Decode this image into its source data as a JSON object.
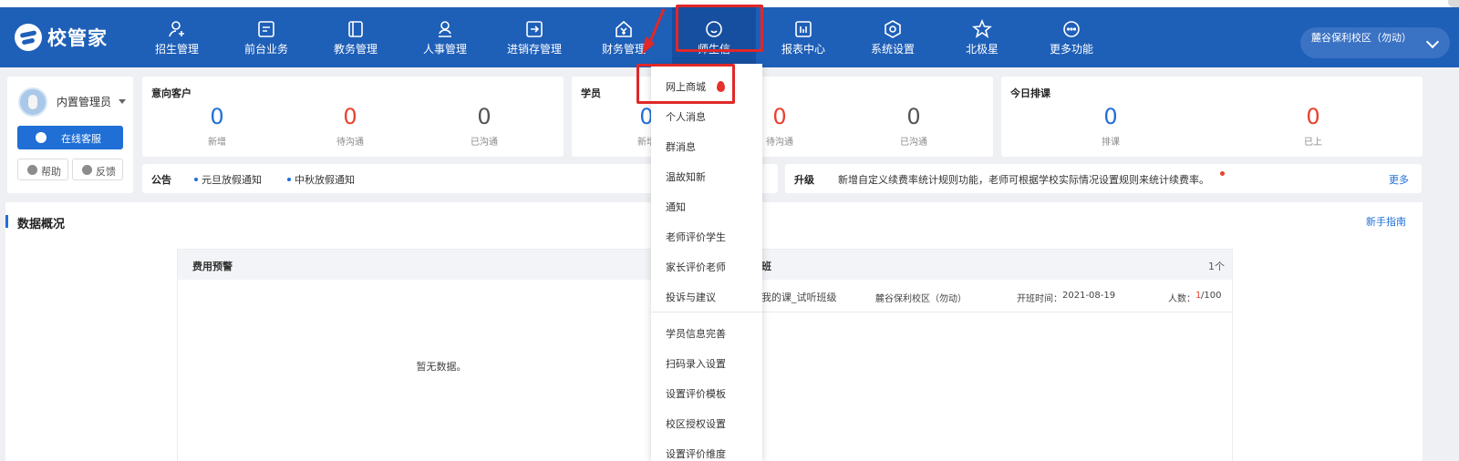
{
  "app": {
    "brand": "校管家"
  },
  "nav": [
    {
      "label": "招生管理",
      "icon": "person-add-icon"
    },
    {
      "label": "前台业务",
      "icon": "reception-icon"
    },
    {
      "label": "教务管理",
      "icon": "book-icon"
    },
    {
      "label": "人事管理",
      "icon": "person-icon"
    },
    {
      "label": "进销存管理",
      "icon": "inventory-icon"
    },
    {
      "label": "财务管理",
      "icon": "finance-icon"
    },
    {
      "label": "师生信",
      "icon": "chat-bubble-icon"
    },
    {
      "label": "报表中心",
      "icon": "report-icon"
    },
    {
      "label": "系统设置",
      "icon": "settings-icon"
    },
    {
      "label": "北极星",
      "icon": "star-icon"
    },
    {
      "label": "更多功能",
      "icon": "more-icon"
    }
  ],
  "campus": {
    "label": "麓谷保利校区（勿动）"
  },
  "user": {
    "name": "内置管理员",
    "online_service": "在线客服",
    "help": "帮助",
    "feedback": "反馈"
  },
  "stats": {
    "leads": {
      "title": "意向客户",
      "items": [
        {
          "value": "0",
          "label": "新增"
        },
        {
          "value": "0",
          "label": "待沟通"
        },
        {
          "value": "0",
          "label": "已沟通"
        }
      ]
    },
    "students": {
      "title": "学员",
      "items": [
        {
          "value": "0",
          "label": "新增"
        },
        {
          "value": "0",
          "label": "待沟通"
        },
        {
          "value": "0",
          "label": "已沟通"
        }
      ]
    },
    "today": {
      "title": "今日排课",
      "items": [
        {
          "value": "0",
          "label": "排课"
        },
        {
          "value": "0",
          "label": "已上"
        }
      ]
    }
  },
  "notice": {
    "label": "公告",
    "items": [
      "元旦放假通知",
      "中秋放假通知"
    ]
  },
  "upgrade": {
    "label": "升级",
    "text": "新增自定义续费率统计规则功能，老师可根据学校实际情况设置规则来统计续费率。",
    "more": "更多"
  },
  "overview": {
    "title": "数据概况",
    "guide": "新手指南",
    "fee_warning": {
      "title": "费用预警",
      "empty": "暂无数据。"
    },
    "class_panel": {
      "title": "班",
      "count": "1个",
      "row": {
        "name": "我的课_试听班级",
        "campus": "麓谷保利校区（勿动）",
        "start_label": "开班时间：",
        "start_date": "2021-08-19",
        "people_label": "人数：",
        "people_current": "1",
        "people_total": "/100"
      }
    }
  },
  "dropdown": {
    "items": [
      "网上商城",
      "个人消息",
      "群消息",
      "温故知新",
      "通知",
      "老师评价学生",
      "家长评价老师",
      "投诉与建议",
      "学员信息完善",
      "扫码录入设置",
      "设置评价模板",
      "校区授权设置",
      "设置评价维度"
    ]
  },
  "colors": {
    "nav_bg": "#1e5fb8",
    "accent": "#1f6fd6",
    "highlight": "#e02828",
    "number_blue": "#1f6fd6",
    "number_red": "#e8412e",
    "number_gray": "#555555"
  }
}
